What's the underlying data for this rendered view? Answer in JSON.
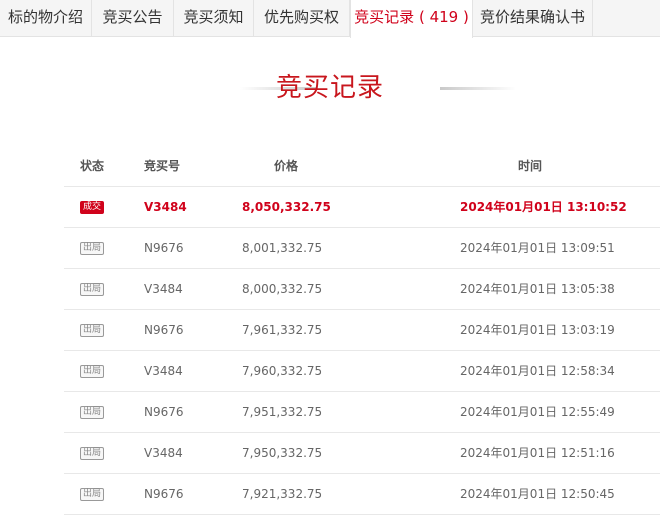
{
  "tabs": [
    {
      "label": "标的物介绍"
    },
    {
      "label": "竞买公告"
    },
    {
      "label": "竞买须知"
    },
    {
      "label": "优先购买权"
    },
    {
      "label": "竞买记录",
      "count": "( 419 )"
    },
    {
      "label": "竞价结果确认书"
    }
  ],
  "section_title": "竞买记录",
  "table": {
    "headers": {
      "status": "状态",
      "bid_no": "竞买号",
      "price": "价格",
      "time": "时间"
    },
    "rows": [
      {
        "status": "成交",
        "bid_no": "V3484",
        "price": "8,050,332.75",
        "time": "2024年01月01日 13:10:52"
      },
      {
        "status": "出局",
        "bid_no": "N9676",
        "price": "8,001,332.75",
        "time": "2024年01月01日 13:09:51"
      },
      {
        "status": "出局",
        "bid_no": "V3484",
        "price": "8,000,332.75",
        "time": "2024年01月01日 13:05:38"
      },
      {
        "status": "出局",
        "bid_no": "N9676",
        "price": "7,961,332.75",
        "time": "2024年01月01日 13:03:19"
      },
      {
        "status": "出局",
        "bid_no": "V3484",
        "price": "7,960,332.75",
        "time": "2024年01月01日 12:58:34"
      },
      {
        "status": "出局",
        "bid_no": "N9676",
        "price": "7,951,332.75",
        "time": "2024年01月01日 12:55:49"
      },
      {
        "status": "出局",
        "bid_no": "V3484",
        "price": "7,950,332.75",
        "time": "2024年01月01日 12:51:16"
      },
      {
        "status": "出局",
        "bid_no": "N9676",
        "price": "7,921,332.75",
        "time": "2024年01月01日 12:50:45"
      }
    ]
  },
  "colors": {
    "accent": "#d0021b",
    "title": "#c8161d"
  }
}
